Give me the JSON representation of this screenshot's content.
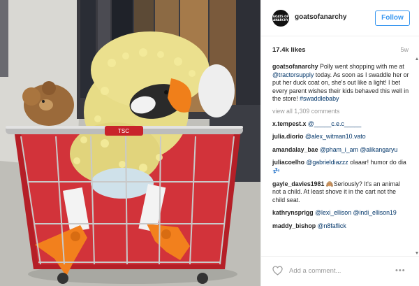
{
  "photo": {
    "alt_theme": "goat in duck costume in shopping cart",
    "cart_handle_text": "TSC"
  },
  "header": {
    "avatar_text": "GOATS OF ANARCHY",
    "username": "goatsofanarchy",
    "follow_label": "Follow"
  },
  "meta": {
    "likes": "17.4k likes",
    "time_ago": "5w"
  },
  "caption": {
    "username": "goatsofanarchy",
    "text_1": " Polly went shopping with me at ",
    "mention": "@tractorsupply",
    "text_2": " today. As soon as I swaddle her or put her duck coat on, she's out like a light! I bet every parent wishes their kids behaved this well in the store! ",
    "hashtag": "#swaddlebaby"
  },
  "view_all": "view all 1,309 comments",
  "comments": [
    {
      "username": "x.tempest.x",
      "mention": "@_____c.e.c_____",
      "text": ""
    },
    {
      "username": "julia.diorio",
      "mention": "@alex_witman10.vato",
      "text": ""
    },
    {
      "username": "amandalay_bae",
      "mention": "@pham_i_am @alikangaryu",
      "text": ""
    },
    {
      "username": "juliacoelho",
      "mention": "@gabrieldiazzz",
      "text": " olaaar! humor do dia 💤"
    },
    {
      "username": "gayle_davies1981",
      "mention": "",
      "text": " 🙈Seriously? It's an animal not a child. At least shove it in the cart not the child seat."
    },
    {
      "username": "kathrynsprigg",
      "mention": "@lexi_ellison @indi_ellison19",
      "text": ""
    },
    {
      "username": "maddy_bishop",
      "mention": "@n8faflick",
      "text": ""
    }
  ],
  "footer": {
    "add_comment_placeholder": "Add a comment...",
    "more_label": "•••"
  },
  "icons": {
    "heart": "heart-icon",
    "more": "more-options-icon",
    "scroll_up": "scroll-up-icon",
    "scroll_down": "scroll-down-icon"
  },
  "colors": {
    "follow_blue": "#3897f0",
    "link_blue": "#003569",
    "muted_gray": "#999999",
    "cart_red": "#c8232b",
    "duck_yellow": "#e8de8a",
    "duck_orange": "#f07f1a"
  }
}
